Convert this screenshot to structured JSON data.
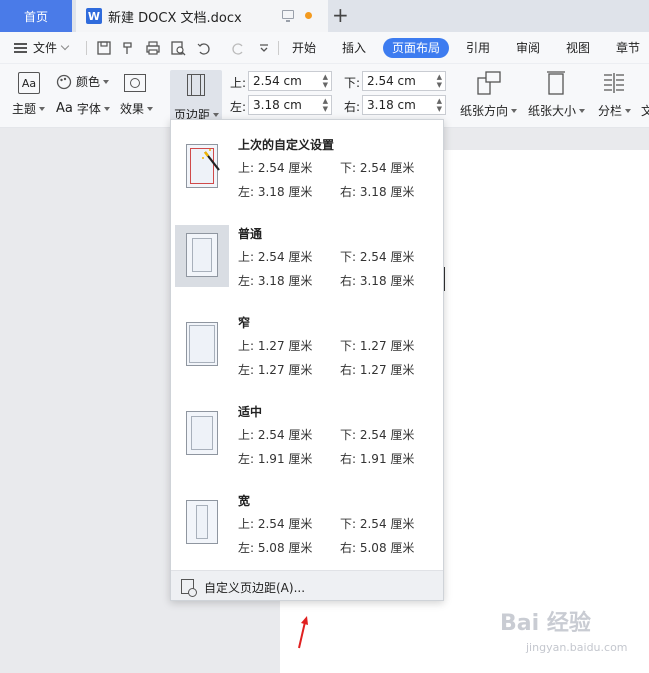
{
  "tabs": {
    "home": "首页",
    "doc_logo": "W",
    "doc_title": "新建 DOCX 文档.docx",
    "plus": "+"
  },
  "menu": {
    "file": "文件",
    "tabs": [
      "开始",
      "插入",
      "页面布局",
      "引用",
      "审阅",
      "视图",
      "章节"
    ],
    "active_tab": "页面布局",
    "accent_color": "#3d7cf0"
  },
  "ribbon": {
    "theme": "主题",
    "theme_icon_text": "Aa",
    "color": "颜色",
    "font_icon_text": "Aa",
    "font": "字体",
    "effect": "效果",
    "margins": "页边距",
    "top_label": "上:",
    "top_value": "2.54 cm",
    "bottom_label": "下:",
    "bottom_value": "2.54 cm",
    "left_label": "左:",
    "left_value": "3.18 cm",
    "right_label": "右:",
    "right_value": "3.18 cm",
    "orientation": "纸张方向",
    "size": "纸张大小",
    "columns": "分栏",
    "overflow": "文"
  },
  "dropdown": {
    "presets": [
      {
        "name": "上次的自定义设置",
        "top": "上: 2.54 厘米",
        "bottom": "下: 2.54 厘米",
        "left": "左: 3.18 厘米",
        "right": "右: 3.18 厘米"
      },
      {
        "name": "普通",
        "top": "上: 2.54 厘米",
        "bottom": "下: 2.54 厘米",
        "left": "左: 3.18 厘米",
        "right": "右: 3.18 厘米"
      },
      {
        "name": "窄",
        "top": "上: 1.27 厘米",
        "bottom": "下: 1.27 厘米",
        "left": "左: 1.27 厘米",
        "right": "右: 1.27 厘米"
      },
      {
        "name": "适中",
        "top": "上: 2.54 厘米",
        "bottom": "下: 2.54 厘米",
        "left": "左: 1.91 厘米",
        "right": "右: 1.91 厘米"
      },
      {
        "name": "宽",
        "top": "上: 2.54 厘米",
        "bottom": "下: 2.54 厘米",
        "left": "左: 5.08 厘米",
        "right": "右: 5.08 厘米"
      }
    ],
    "custom": "自定义页边距(A)..."
  },
  "watermark": {
    "brand": "Bai 经验",
    "url": "jingyan.baidu.com"
  }
}
